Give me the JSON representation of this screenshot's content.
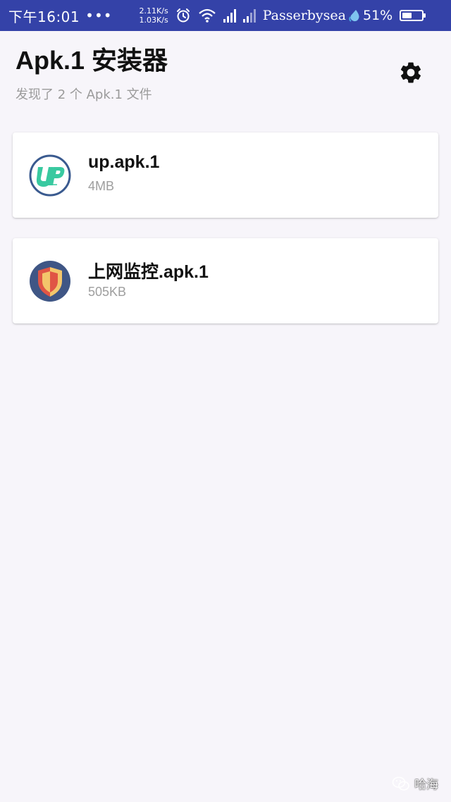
{
  "status_bar": {
    "time": "下午16:01",
    "more": "•••",
    "speed_up": "2.11K/s",
    "speed_down": "1.03K/s",
    "carrier": "Passerbysea",
    "battery_percent": "51%",
    "battery_level": 0.51,
    "icons": [
      "alarm-icon",
      "wifi-icon",
      "signal-icon",
      "signal-icon",
      "water-drop-icon",
      "battery-icon"
    ]
  },
  "header": {
    "title": "Apk.1 安装器",
    "subtitle": "发现了 2 个 Apk.1 文件",
    "settings_icon": "gear-icon"
  },
  "files": [
    {
      "name": "up.apk.1",
      "size": "4MB",
      "icon": "up-app-icon",
      "icon_colors": {
        "bg": "#ffffff",
        "ring": "#3a5a8f",
        "glyph": "#39c9a0"
      }
    },
    {
      "name": "上网监控.apk.1",
      "size": "505KB",
      "icon": "shield-app-icon",
      "icon_colors": {
        "bg": "#3f5685",
        "left": "#e05545",
        "right": "#f3c66b"
      }
    }
  ],
  "watermark": {
    "text": "哈海",
    "icon": "wechat-icon"
  },
  "colors": {
    "status_bar": "#3442a8",
    "background": "#f7f5fa",
    "card": "#ffffff",
    "title_text": "#111111",
    "secondary_text": "#9e9e9e"
  }
}
